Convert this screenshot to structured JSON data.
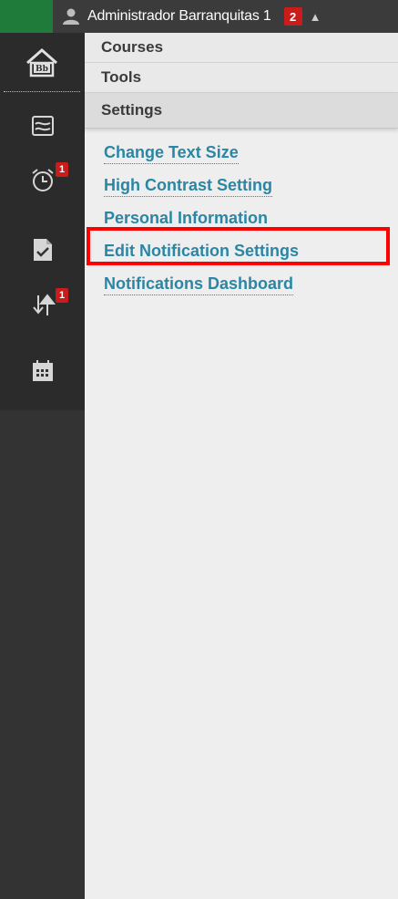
{
  "topbar": {
    "user_name": "Administrador Barranquitas 1",
    "notification_count": "2",
    "caret": "▲"
  },
  "rail": {
    "items": [
      {
        "name": "home",
        "icon": "home-bb-icon"
      },
      {
        "name": "activity-stream",
        "icon": "stream-icon"
      },
      {
        "name": "due-dates",
        "icon": "alarm-clock-icon",
        "badge": "1"
      },
      {
        "name": "grades",
        "icon": "document-check-icon"
      },
      {
        "name": "updates",
        "icon": "arrows-up-down-icon",
        "badge": "1"
      },
      {
        "name": "calendar",
        "icon": "calendar-icon"
      }
    ]
  },
  "main": {
    "tabs": [
      {
        "label": "Courses"
      },
      {
        "label": "Tools"
      },
      {
        "label": "Settings"
      }
    ],
    "settings_links": [
      {
        "label": "Change Text Size"
      },
      {
        "label": "High Contrast Setting"
      },
      {
        "label": "Personal Information"
      },
      {
        "label": "Edit Notification Settings"
      },
      {
        "label": "Notifications Dashboard"
      }
    ]
  },
  "colors": {
    "link": "#2a86a4",
    "highlight": "#ff0000",
    "badge": "#cc1b1b",
    "topbar": "#3b3b3b",
    "brand_green": "#1e7b3a"
  }
}
